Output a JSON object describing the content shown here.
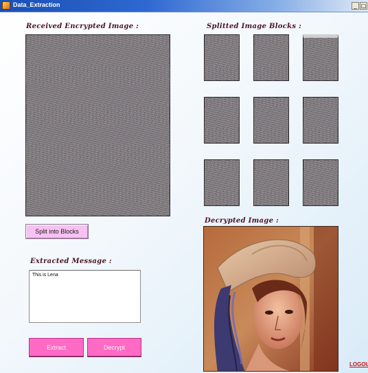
{
  "window": {
    "title": "Data_Extraction",
    "controls": {
      "minimize": "_",
      "maximize": "□"
    }
  },
  "received": {
    "heading": "Received Encrypted Image  :"
  },
  "blocks": {
    "heading": "Splitted Image Blocks :",
    "count": 9
  },
  "split_button": {
    "label": "Split into Blocks"
  },
  "extracted": {
    "heading": "Extracted Message :",
    "value": "This is Lena"
  },
  "actions": {
    "extract_label": "Extract",
    "decrypt_label": "Decrypt"
  },
  "decrypted": {
    "heading": "Decrypted Image  :"
  },
  "logout": {
    "label": "LOGOUT"
  },
  "colors": {
    "title_bar": "#2f68d2",
    "heading_text": "#4a1222",
    "button_pink": "#f7c1f2",
    "button_magenta": "#ff6ac5",
    "logout": "#c01818"
  }
}
